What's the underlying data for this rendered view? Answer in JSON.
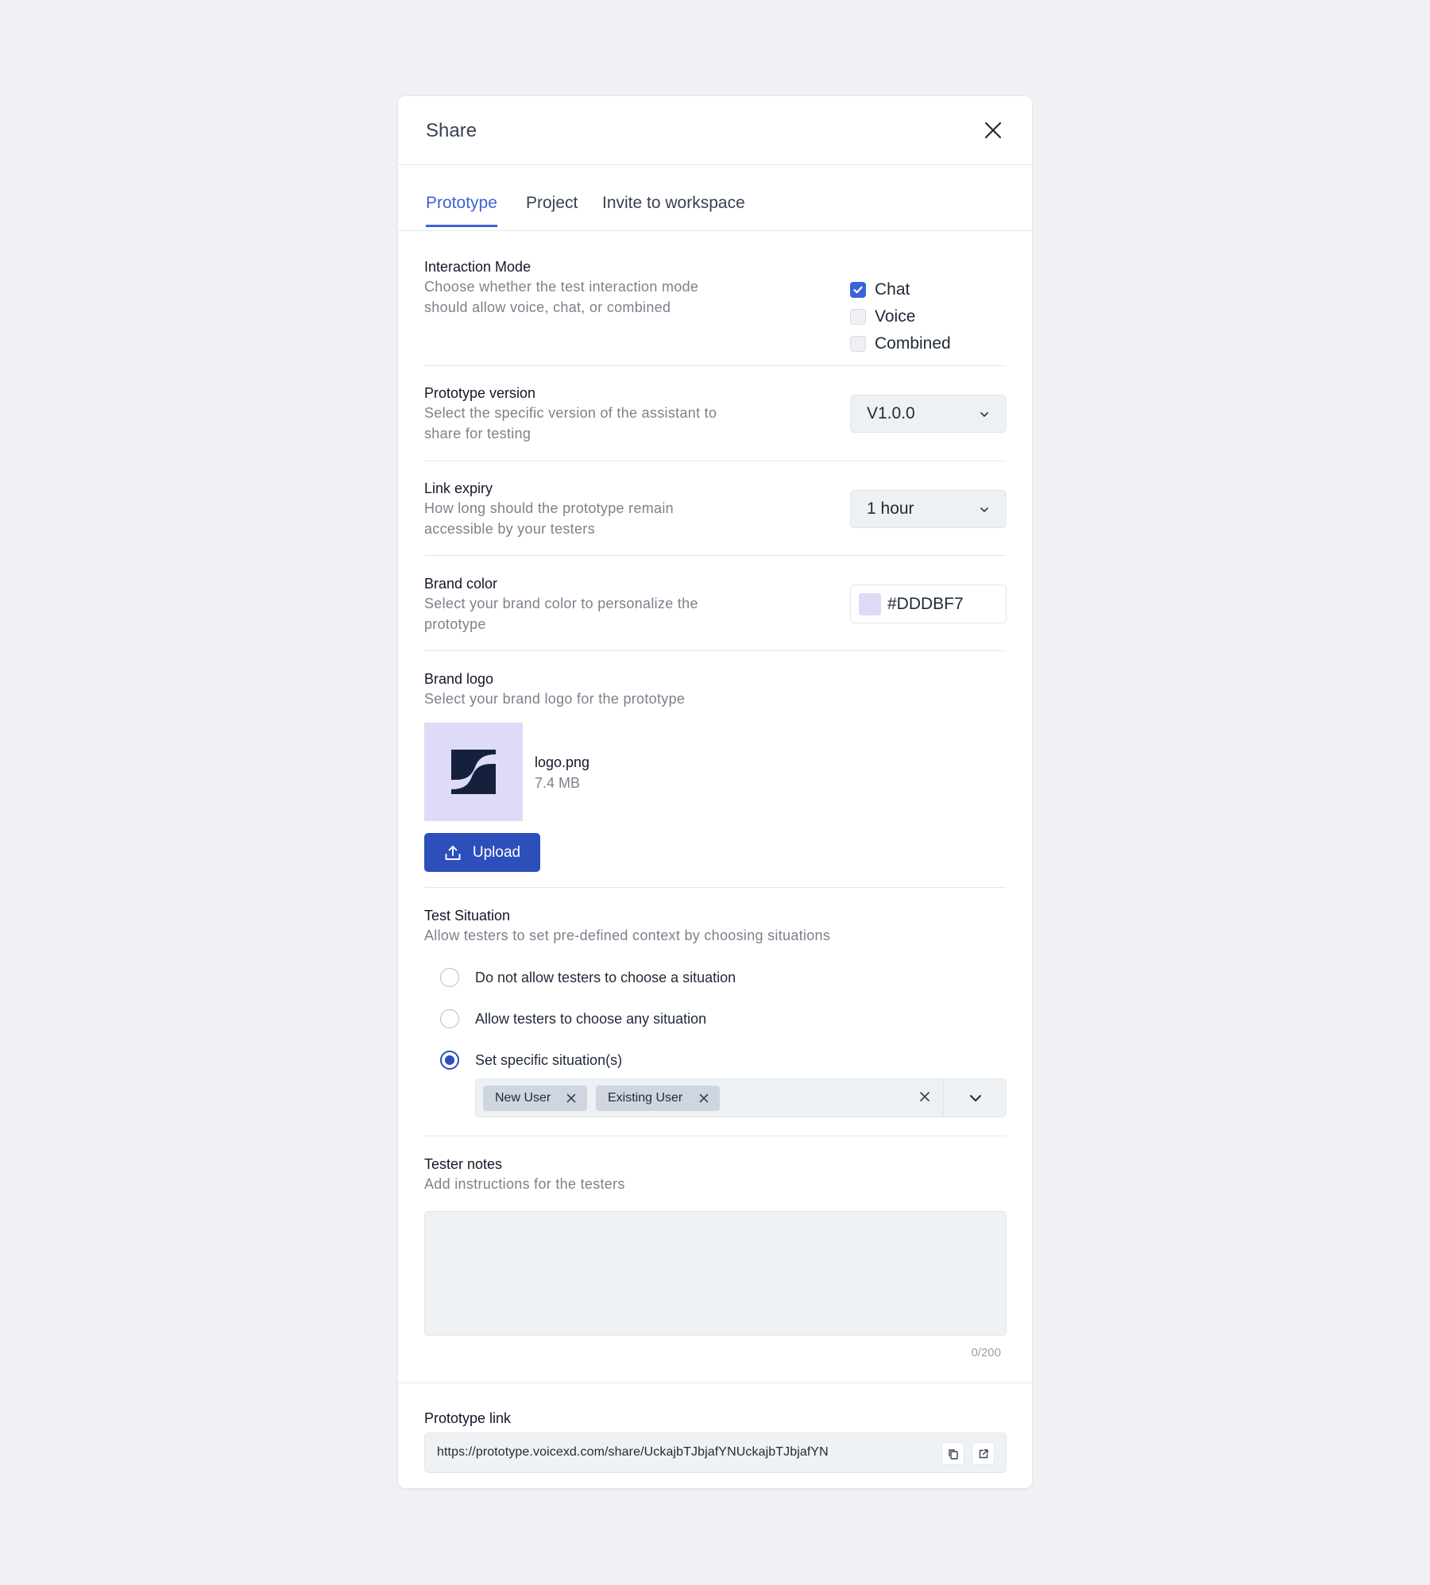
{
  "modal": {
    "title": "Share"
  },
  "tabs": [
    {
      "label": "Prototype",
      "active": true
    },
    {
      "label": "Project",
      "active": false
    },
    {
      "label": "Invite to workspace",
      "active": false
    }
  ],
  "interaction_mode": {
    "label": "Interaction Mode",
    "description_line1": "Choose whether the test interaction mode",
    "description_line2": "should allow voice, chat, or combined",
    "options": [
      {
        "label": "Chat",
        "checked": true
      },
      {
        "label": "Voice",
        "checked": false
      },
      {
        "label": "Combined",
        "checked": false
      }
    ]
  },
  "prototype_version": {
    "label": "Prototype version",
    "description_line1": "Select the specific version of the assistant to",
    "description_line2": "share for testing",
    "value": "V1.0.0"
  },
  "link_expiry": {
    "label": "Link expiry",
    "description_line1": "How long should the prototype remain",
    "description_line2": "accessible by your testers",
    "value": "1 hour"
  },
  "brand_color": {
    "label": "Brand color",
    "description_line1": "Select your brand color to personalize the",
    "description_line2": "prototype",
    "value": "#DDDBF7"
  },
  "brand_logo": {
    "label": "Brand logo",
    "description": "Select your brand logo for the prototype",
    "file_name": "logo.png",
    "file_size": "7.4 MB",
    "upload_label": "Upload"
  },
  "test_situation": {
    "label": "Test Situation",
    "description": "Allow testers to set pre-defined context by choosing situations",
    "options": [
      {
        "label": "Do not allow testers to choose a situation",
        "selected": false
      },
      {
        "label": "Allow testers to choose any situation",
        "selected": false
      },
      {
        "label": "Set specific situation(s)",
        "selected": true
      }
    ],
    "chips": [
      "New User",
      "Existing User"
    ]
  },
  "tester_notes": {
    "label": "Tester notes",
    "description": "Add instructions for the testers",
    "value": "",
    "counter": "0/200"
  },
  "prototype_link": {
    "label": "Prototype link",
    "url": "https://prototype.voicexd.com/share/UckajbTJbjafYNUckajbTJbjafYN"
  },
  "colors": {
    "accent": "#3a63d8",
    "button": "#2d4fbb",
    "brand": "#DDDBF7"
  }
}
